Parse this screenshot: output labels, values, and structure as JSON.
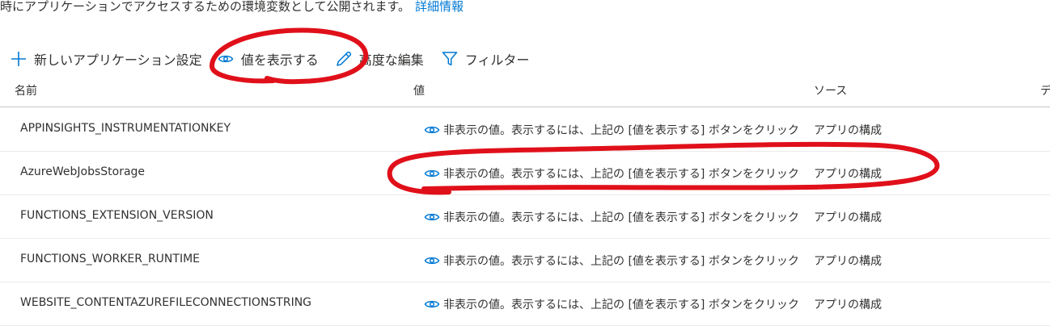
{
  "description": {
    "text": "時にアプリケーションでアクセスするための環境変数として公開されます。",
    "link": "詳細情報"
  },
  "toolbar": {
    "add_label": "新しいアプリケーション設定",
    "show_values_label": "値を表示する",
    "advanced_edit_label": "高度な編集",
    "filter_label": "フィルター"
  },
  "table": {
    "headers": {
      "name": "名前",
      "value": "値",
      "source": "ソース",
      "extra": "デ"
    },
    "rows": [
      {
        "name": "APPINSIGHTS_INSTRUMENTATIONKEY",
        "value": "非表示の値。表示するには、上記の [値を表示する] ボタンをクリック",
        "source": "アプリの構成"
      },
      {
        "name": "AzureWebJobsStorage",
        "value": "非表示の値。表示するには、上記の [値を表示する] ボタンをクリック",
        "source": "アプリの構成"
      },
      {
        "name": "FUNCTIONS_EXTENSION_VERSION",
        "value": "非表示の値。表示するには、上記の [値を表示する] ボタンをクリック",
        "source": "アプリの構成"
      },
      {
        "name": "FUNCTIONS_WORKER_RUNTIME",
        "value": "非表示の値。表示するには、上記の [値を表示する] ボタンをクリック",
        "source": "アプリの構成"
      },
      {
        "name": "WEBSITE_CONTENTAZUREFILECONNECTIONSTRING",
        "value": "非表示の値。表示するには、上記の [値を表示する] ボタンをクリック",
        "source": "アプリの構成"
      }
    ]
  },
  "colors": {
    "accent": "#0078d4",
    "annotation": "#e0101a",
    "text": "#323130"
  }
}
